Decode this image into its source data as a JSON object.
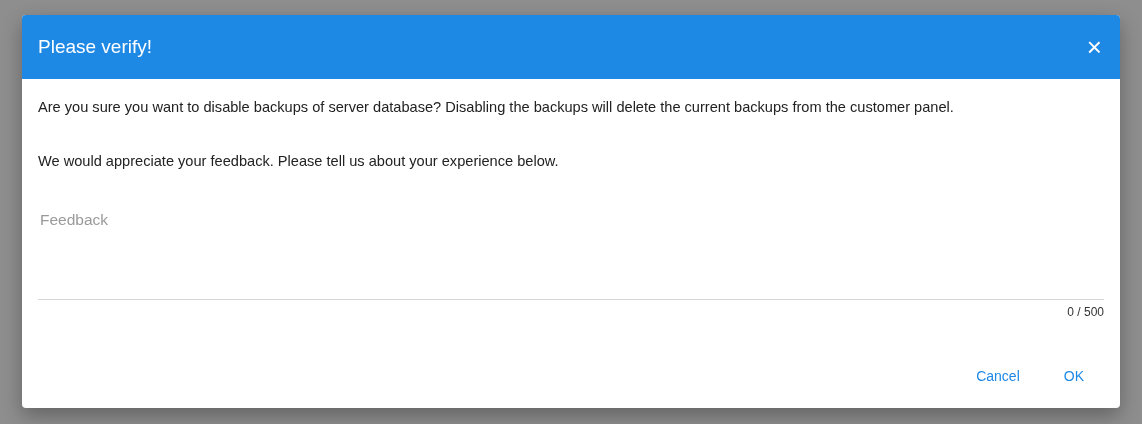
{
  "dialog": {
    "title": "Please verify!",
    "close": "×",
    "message": "Are you sure you want to disable backups of server database? Disabling the backups will delete the current backups from the customer panel.",
    "prompt": "We would appreciate your feedback. Please tell us about your experience below.",
    "feedback": {
      "placeholder": "Feedback",
      "counter": "0 / 500"
    },
    "buttons": [
      "Cancel",
      "OK"
    ]
  }
}
